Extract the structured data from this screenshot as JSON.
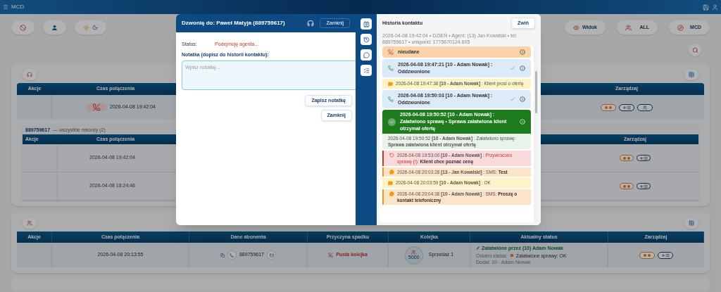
{
  "topbar": {
    "title": "MCD"
  },
  "toolbar": {
    "right": [
      {
        "label": "Widok"
      },
      {
        "label": "ALL"
      },
      {
        "label": "MCD"
      }
    ]
  },
  "panel1": {
    "columns": [
      "Akcje",
      "Czas połączenia",
      "Zarządzaj"
    ],
    "row": {
      "time": "2026-04-08 19:42:04"
    },
    "subtable": {
      "caption_number": "889759617",
      "caption": "— wszystkie rekordy (2)",
      "columns": [
        "Akcje",
        "Czas połączenia",
        "Zarządzaj"
      ],
      "rows": [
        "2026-04-08 19:42:04",
        "2026-04-08 18:24:46"
      ]
    }
  },
  "panel2": {
    "columns": [
      "Akcje",
      "Czas połączenia",
      "Dane abonenta",
      "Przyczyna spadku",
      "Kolejka",
      "Aktualny status",
      "Zarządzaj"
    ],
    "row": {
      "time": "2026-04-08 20:13:55",
      "phone": "889759617",
      "reason": "Pusta kolejka",
      "queue_number": "5000",
      "queue_name": "Sprzedaż 1",
      "status_title": "✓ Załatwione przez (10) Adam Nowak",
      "last_status_label": "Ostatni status:",
      "last_status": "Załatwione sprawy: OK",
      "added_by": "Dodał: 10 - Adam Nowak"
    }
  },
  "call_dialog": {
    "title": "Dzwonię do: Paweł Matyja (889759617)",
    "close_top": "Zamknij",
    "status_label": "Status:",
    "status_value": "Podejmuję agenta...",
    "note_label": "Notatka (dopisz do historii kontaktu):",
    "note_placeholder": "Wpisz notatkę...",
    "save_button": "Zapisz notatkę",
    "close_button": "Zamknij"
  },
  "history": {
    "title": "Historia kontaktu",
    "collapse": "Zwiń",
    "meta": "2026-04-08 19:42:04 • DZIEŃ • Agent: (13) Jan Kowalski • tel: 889759617 • uniqueid: 1775670124.605",
    "entries": [
      {
        "kind": "call_failed",
        "head": "nieudane"
      },
      {
        "kind": "call_ok",
        "head": "2026-04-08 19:47:21 [10 - Adam Nowak] :",
        "detail": "Oddzwonione",
        "confirmed": true
      },
      {
        "kind": "note",
        "head": "2026-04-08 19:47:38 **[10 - Adam Nowak]** : Klient prosi o ofertę"
      },
      {
        "kind": "call_ok",
        "head": "2026-04-08 19:50:03 [10 - Adam Nowak] :",
        "detail": "Oddzwonione",
        "confirmed": true
      },
      {
        "kind": "resolved",
        "head": "2026-04-08 19:50:52 [10 - Adam Nowak] : Załatwiono sprawę • Sprawa załatwiona klient otrzymał ofertę",
        "body": "2026-04-08 19:50:52 **[10 - Adam Nowak]** : Załatwiono sprawę:  **Sprawa załatwiona klient otrzymał ofertę**"
      },
      {
        "kind": "restored",
        "head": "2026-04-08 19:53:00 **[10 - Adam Nowak]** :",
        "status": "Przywrócono sprawę (!):",
        "detail": "Klient chce poznać cenę"
      },
      {
        "kind": "sms",
        "head": "2026-04-08 20:03:28 **[13 - Jan Kowalski]** : SMS:",
        "detail": "Test"
      },
      {
        "kind": "note",
        "head": "2026-04-08 20:03:59 **[10 - Adam Nowak]** : OK"
      },
      {
        "kind": "sms",
        "head": "2026-04-08 20:04:38 **[10 - Adam Nowak]** : SMS:",
        "detail": "Proszę o kontakt telefoniczny"
      }
    ]
  }
}
